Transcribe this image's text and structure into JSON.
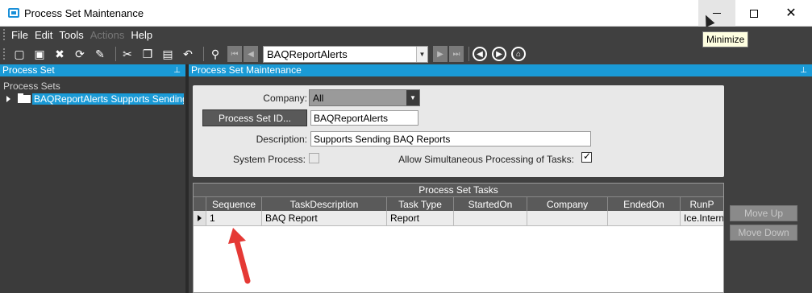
{
  "window": {
    "title": "Process Set Maintenance",
    "tooltip": "Minimize"
  },
  "menu": [
    "File",
    "Edit",
    "Tools",
    "Actions",
    "Help"
  ],
  "menu_disabled": [
    "Actions"
  ],
  "toolbar": {
    "icons": [
      "new-icon",
      "save-icon",
      "delete-icon",
      "refresh-icon",
      "clear-icon",
      "cut-icon",
      "copy-icon",
      "paste-icon",
      "undo-icon",
      "search-icon"
    ],
    "combo_value": "BAQReportAlerts"
  },
  "left_panel": {
    "header": "Process Set",
    "tree_root": "Process Sets",
    "tree_item": "BAQReportAlerts  Supports Sending BAQ Reports"
  },
  "main_panel": {
    "header": "Process Set Maintenance",
    "company_label": "Company:",
    "company_value": "All",
    "process_set_id_button": "Process Set ID...",
    "process_set_id_value": "BAQReportAlerts",
    "description_label": "Description:",
    "description_value": "Supports Sending BAQ Reports",
    "system_process_label": "System Process:",
    "system_process_checked": false,
    "simultaneous_label": "Allow Simultaneous Processing of Tasks:",
    "simultaneous_checked": true
  },
  "tasks_grid": {
    "caption": "Process Set Tasks",
    "columns": [
      "Sequence",
      "TaskDescription",
      "Task Type",
      "StartedOn",
      "Company",
      "EndedOn",
      "RunP"
    ],
    "rows": [
      [
        "1",
        "BAQ Report",
        "Report",
        "",
        "",
        "",
        "Ice.Intern"
      ]
    ]
  },
  "side_buttons": {
    "move_up": "Move Up",
    "move_down": "Move Down"
  },
  "colors": {
    "accent": "#1a9ad6",
    "dark_bg": "#404040",
    "annotation": "#e53935"
  }
}
